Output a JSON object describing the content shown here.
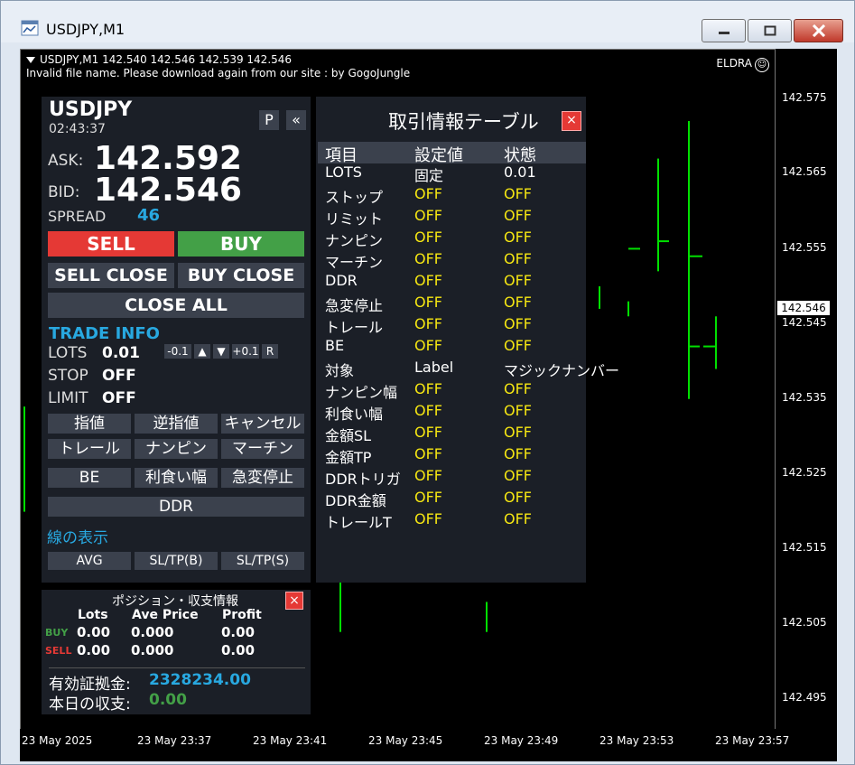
{
  "window": {
    "title": "USDJPY,M1"
  },
  "chart": {
    "header_line1": "USDJPY,M1  142.540 142.546 142.539 142.546",
    "header_line2": "Invalid file name. Please download again from our site : by GogoJungle",
    "ea_name": "ELDRA",
    "ea_icon": "smiley-icon",
    "current_price": "142.546",
    "y_ticks": [
      "142.575",
      "142.565",
      "142.555",
      "142.545",
      "142.535",
      "142.525",
      "142.515",
      "142.505",
      "142.495"
    ],
    "x_ticks": [
      "23 May 2025",
      "23 May 23:37",
      "23 May 23:41",
      "23 May 23:45",
      "23 May 23:49",
      "23 May 23:53",
      "23 May 23:57"
    ],
    "bar_color": "#00e000"
  },
  "trade_panel": {
    "symbol": "USDJPY",
    "time": "02:43:37",
    "p_label": "P",
    "collapse_label": "«",
    "ask_label": "ASK:",
    "ask": "142.592",
    "bid_label": "BID:",
    "bid": "142.546",
    "spread_label": "SPREAD",
    "spread": "46",
    "sell": "SELL",
    "buy": "BUY",
    "sell_close": "SELL CLOSE",
    "buy_close": "BUY CLOSE",
    "close_all": "CLOSE ALL",
    "trade_info": "TRADE INFO",
    "lots_label": "LOTS",
    "lots": "0.01",
    "minus": "-0.1",
    "up": "▲",
    "down": "▼",
    "plus": "+0.1",
    "reset": "R",
    "stop_label": "STOP",
    "stop": "OFF",
    "limit_label": "LIMIT",
    "limit": "OFF",
    "grid": [
      "指値",
      "逆指値",
      "キャンセル",
      "トレール",
      "ナンピン",
      "マーチン",
      "BE",
      "利食い幅",
      "急変停止"
    ],
    "ddr": "DDR",
    "line_display": "線の表示",
    "avg": "AVG",
    "sltp_b": "SL/TP(B)",
    "sltp_s": "SL/TP(S)",
    "sell_color": "#e53935",
    "buy_color": "#43a047",
    "accent": "#28a8e0"
  },
  "position_panel": {
    "title": "ポジション・収支情報",
    "close": "×",
    "headers": [
      "Lots",
      "Ave Price",
      "Profit"
    ],
    "buy_label": "BUY",
    "sell_label": "SELL",
    "buy_row": [
      "0.00",
      "0.000",
      "0.00"
    ],
    "sell_row": [
      "0.00",
      "0.000",
      "0.00"
    ],
    "margin_label": "有効証拠金:",
    "margin": "2328234.00",
    "today_label": "本日の収支:",
    "today": "0.00"
  },
  "table_panel": {
    "title": "取引情報テーブル",
    "close": "×",
    "headers": [
      "項目",
      "設定値",
      "状態"
    ],
    "rows": [
      [
        "LOTS",
        "固定",
        "0.01"
      ],
      [
        "ストップ",
        "OFF",
        "OFF"
      ],
      [
        "リミット",
        "OFF",
        "OFF"
      ],
      [
        "ナンピン",
        "OFF",
        "OFF"
      ],
      [
        "マーチン",
        "OFF",
        "OFF"
      ],
      [
        "DDR",
        "OFF",
        "OFF"
      ],
      [
        "急変停止",
        "OFF",
        "OFF"
      ],
      [
        "トレール",
        "OFF",
        "OFF"
      ],
      [
        "BE",
        "OFF",
        "OFF"
      ],
      [
        "対象",
        "Label",
        "マジックナンバー"
      ],
      [
        "ナンピン幅",
        "OFF",
        "OFF"
      ],
      [
        "利食い幅",
        "OFF",
        "OFF"
      ],
      [
        "金額SL",
        "OFF",
        "OFF"
      ],
      [
        "金額TP",
        "OFF",
        "OFF"
      ],
      [
        "DDRトリガ",
        "OFF",
        "OFF"
      ],
      [
        "DDR金額",
        "OFF",
        "OFF"
      ],
      [
        "トレールT",
        "OFF",
        "OFF"
      ]
    ],
    "off_color": "#f5e612"
  }
}
